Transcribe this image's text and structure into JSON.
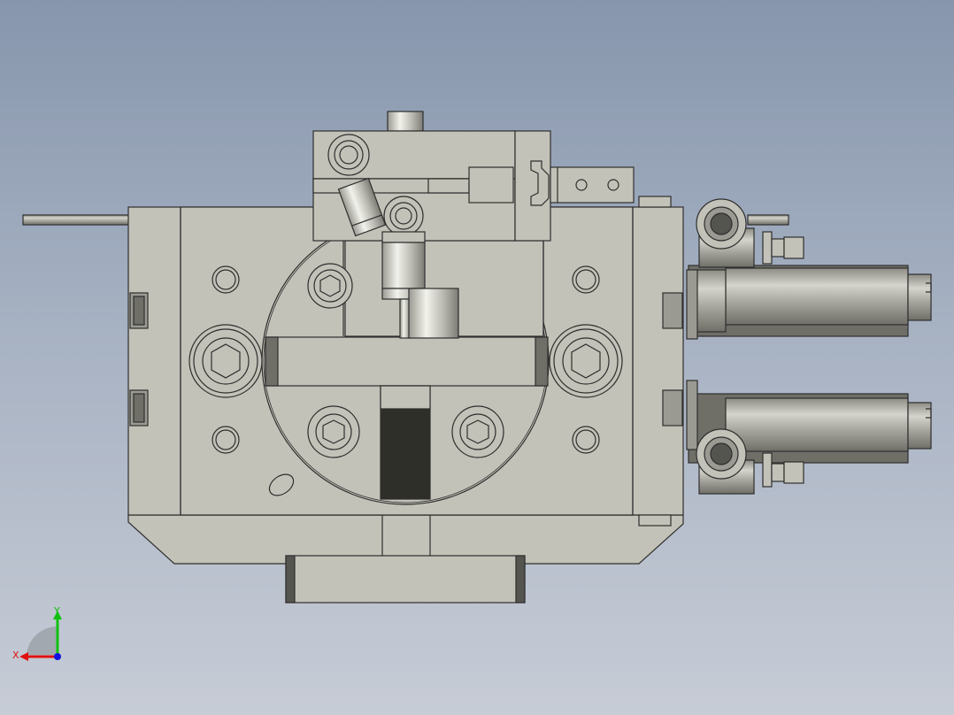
{
  "viewport": {
    "background_top": "#8796ad",
    "background_bottom": "#c7ccd6",
    "part_color": "#c3c2b8",
    "shaft_color": "#a9a9a1",
    "edge_color": "#2e2e2e"
  },
  "triad": {
    "x_label": "X",
    "y_label": "Y",
    "x_color": "#e01010",
    "y_color": "#10c010",
    "z_color": "#1010e0"
  }
}
